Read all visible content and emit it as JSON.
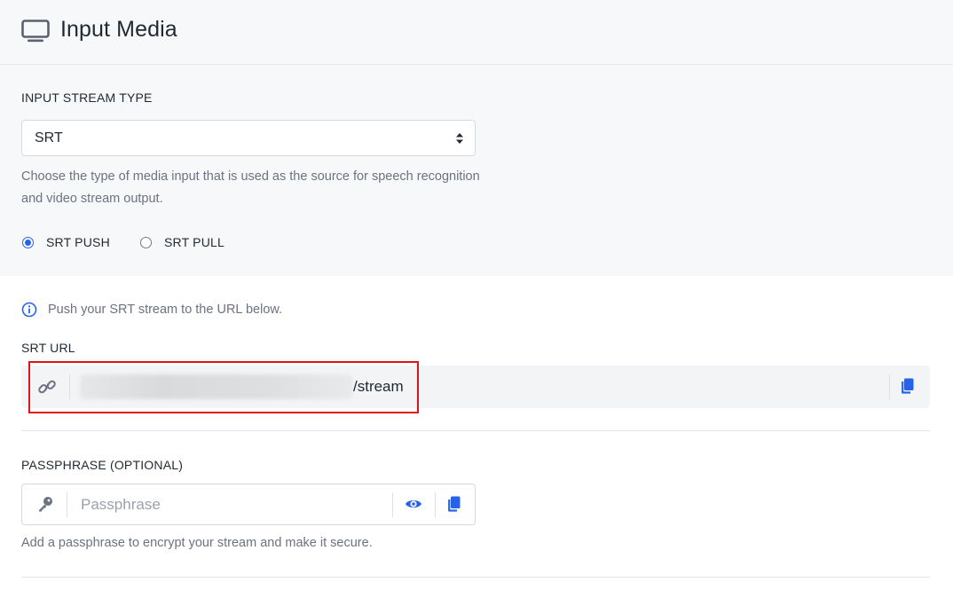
{
  "header": {
    "title": "Input Media",
    "icon": "monitor-icon"
  },
  "input_stream": {
    "label": "INPUT STREAM TYPE",
    "selected": "SRT",
    "help": "Choose the type of media input that is used as the source for speech recognition and video stream output.",
    "modes": [
      {
        "label": "SRT PUSH",
        "checked": true
      },
      {
        "label": "SRT PULL",
        "checked": false
      }
    ]
  },
  "srt": {
    "info": "Push your SRT stream to the URL below.",
    "url_label": "SRT URL",
    "url_suffix": "/stream"
  },
  "passphrase": {
    "label": "PASSPHRASE (OPTIONAL)",
    "placeholder": "Passphrase",
    "value": "",
    "help": "Add a passphrase to encrypt your stream and make it secure."
  },
  "colors": {
    "accent": "#2563eb",
    "highlight": "#e0121a"
  }
}
